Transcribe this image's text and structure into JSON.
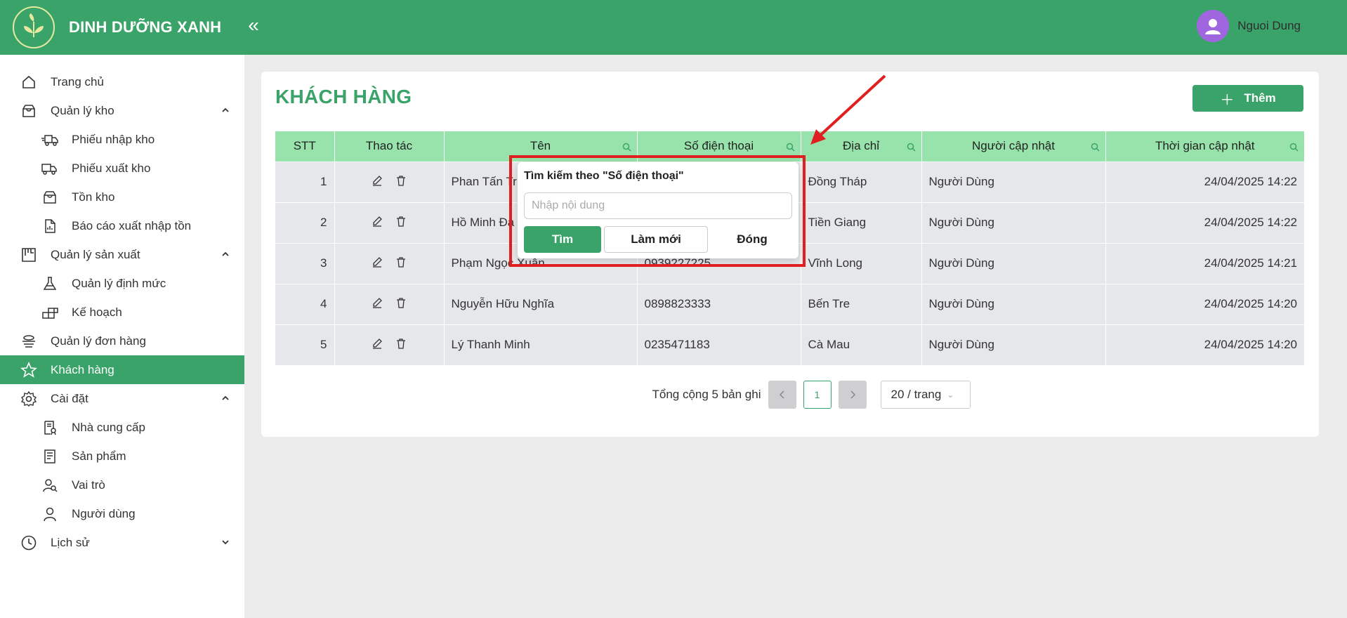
{
  "brand": {
    "name": "DINH DƯỠNG XANH",
    "collapse_icon": "«"
  },
  "user": {
    "name": "Nguoi Dung"
  },
  "sidebar": {
    "items": [
      {
        "label": "Trang chủ",
        "icon": "home-icon"
      },
      {
        "label": "Quản lý kho",
        "icon": "box-icon",
        "expanded": true
      },
      {
        "label": "Phiếu nhập kho",
        "icon": "truck-in-icon"
      },
      {
        "label": "Phiếu xuất kho",
        "icon": "truck-out-icon"
      },
      {
        "label": "Tồn kho",
        "icon": "inventory-icon"
      },
      {
        "label": "Báo cáo xuất nhập tồn",
        "icon": "report-icon"
      },
      {
        "label": "Quản lý sản xuất",
        "icon": "factory-icon",
        "expanded": true
      },
      {
        "label": "Quản lý định mức",
        "icon": "flask-icon"
      },
      {
        "label": "Kế hoạch",
        "icon": "blocks-icon"
      },
      {
        "label": "Quản lý đơn hàng",
        "icon": "orders-icon"
      },
      {
        "label": "Khách hàng",
        "icon": "star-icon",
        "active": true
      },
      {
        "label": "Cài đặt",
        "icon": "gear-icon",
        "expanded": true
      },
      {
        "label": "Nhà cung cấp",
        "icon": "supplier-icon"
      },
      {
        "label": "Sản phẩm",
        "icon": "product-icon"
      },
      {
        "label": "Vai trò",
        "icon": "roles-icon"
      },
      {
        "label": "Người dùng",
        "icon": "user-icon"
      },
      {
        "label": "Lịch sử",
        "icon": "history-icon",
        "expanded": false
      }
    ]
  },
  "page": {
    "title": "KHÁCH HÀNG",
    "add_label": "Thêm"
  },
  "table": {
    "headers": [
      "STT",
      "Thao tác",
      "Tên",
      "Số điện thoại",
      "Địa chỉ",
      "Người cập nhật",
      "Thời gian cập nhật"
    ],
    "rows": [
      {
        "stt": "1",
        "name": "Phan Tấn Tr",
        "phone": "",
        "address": "Đồng Tháp",
        "updater": "Người Dùng",
        "time": "24/04/2025 14:22"
      },
      {
        "stt": "2",
        "name": "Hồ Minh Đạ",
        "phone": "",
        "address": "Tiền Giang",
        "updater": "Người Dùng",
        "time": "24/04/2025 14:22"
      },
      {
        "stt": "3",
        "name": "Phạm Ngọc Xuân",
        "phone": "0939227225",
        "address": "Vĩnh Long",
        "updater": "Người Dùng",
        "time": "24/04/2025 14:21"
      },
      {
        "stt": "4",
        "name": "Nguyễn Hữu Nghĩa",
        "phone": "0898823333",
        "address": "Bến Tre",
        "updater": "Người Dùng",
        "time": "24/04/2025 14:20"
      },
      {
        "stt": "5",
        "name": "Lý Thanh Minh",
        "phone": "0235471183",
        "address": "Cà Mau",
        "updater": "Người Dùng",
        "time": "24/04/2025 14:20"
      }
    ]
  },
  "pagination": {
    "total": "Tổng cộng 5 bản ghi",
    "current": "1",
    "page_size": "20 / trang"
  },
  "popup": {
    "title": "Tìm kiếm theo \"Số điện thoại\"",
    "placeholder": "Nhập nội dung",
    "find": "Tìm",
    "reset": "Làm mới",
    "close": "Đóng"
  }
}
